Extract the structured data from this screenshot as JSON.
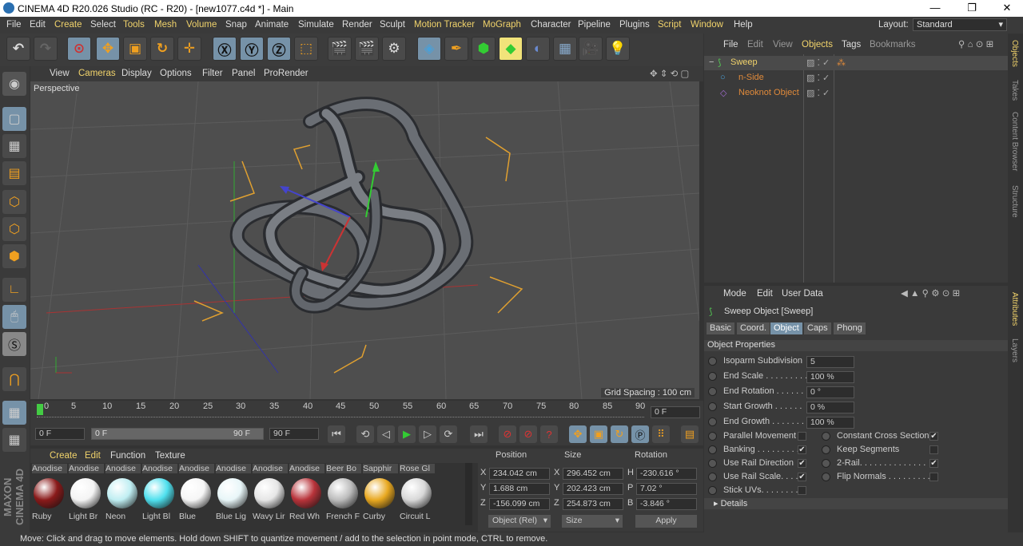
{
  "window": {
    "title": "CINEMA 4D R20.026 Studio (RC - R20) - [new1077.c4d *] - Main",
    "minimize": "—",
    "maximize": "❐",
    "close": "✕"
  },
  "menu": [
    "File",
    "Edit",
    "Create",
    "Select",
    "Tools",
    "Mesh",
    "Volume",
    "Snap",
    "Animate",
    "Simulate",
    "Render",
    "Sculpt",
    "Motion Tracker",
    "MoGraph",
    "Character",
    "Pipeline",
    "Plugins",
    "Script",
    "Window",
    "Help"
  ],
  "layout": {
    "label": "Layout:",
    "value": "Standard"
  },
  "viewport": {
    "menu": [
      "View",
      "Cameras",
      "Display",
      "Options",
      "Filter",
      "Panel",
      "ProRender"
    ],
    "label": "Perspective",
    "grid_spacing": "Grid Spacing : 100 cm"
  },
  "timeline": {
    "ticks": [
      "0",
      "5",
      "10",
      "15",
      "20",
      "25",
      "30",
      "35",
      "40",
      "45",
      "50",
      "55",
      "60",
      "65",
      "70",
      "75",
      "80",
      "85",
      "90"
    ],
    "current_frame": "0 F"
  },
  "controls": {
    "start": "0 F",
    "range_start": "0 F",
    "range_end": "90 F",
    "end": "90 F"
  },
  "materials": {
    "menu": [
      "Create",
      "Edit",
      "Function",
      "Texture"
    ],
    "items": [
      {
        "top": "Anodise",
        "bottom": "Ruby",
        "color": "#8a1a1a"
      },
      {
        "top": "Anodise",
        "bottom": "Light Br",
        "color": "#f4f4f4"
      },
      {
        "top": "Anodise",
        "bottom": "Neon",
        "color": "#bfeef2"
      },
      {
        "top": "Anodise",
        "bottom": "Light Bl",
        "color": "#4fe0ee"
      },
      {
        "top": "Anodise",
        "bottom": "Blue",
        "color": "#f6f6f6"
      },
      {
        "top": "Anodise",
        "bottom": "Blue Lig",
        "color": "#e8f6f8"
      },
      {
        "top": "Anodise",
        "bottom": "Wavy Lir",
        "color": "#e6e6e6"
      },
      {
        "top": "Anodise",
        "bottom": "Red Wh",
        "color": "#b8333a"
      },
      {
        "top": "Beer Bo",
        "bottom": "French F",
        "color": "#bcbcbc"
      },
      {
        "top": "Sapphir",
        "bottom": "Curby",
        "color": "#e8a820"
      },
      {
        "top": "Rose Gl",
        "bottom": "Circuit L",
        "color": "#d8d8d8"
      }
    ]
  },
  "coords": {
    "headers": [
      "Position",
      "Size",
      "Rotation"
    ],
    "rows": [
      {
        "axis": "X",
        "pos": "234.042 cm",
        "saxis": "X",
        "size": "296.452 cm",
        "raxis": "H",
        "rot": "-230.616 °"
      },
      {
        "axis": "Y",
        "pos": "1.688 cm",
        "saxis": "Y",
        "size": "202.423 cm",
        "raxis": "P",
        "rot": "7.02 °"
      },
      {
        "axis": "Z",
        "pos": "-156.099 cm",
        "saxis": "Z",
        "size": "254.873 cm",
        "raxis": "B",
        "rot": "-3.846 °"
      }
    ],
    "mode": "Object (Rel)",
    "size_mode": "Size",
    "apply": "Apply"
  },
  "objects": {
    "menu": [
      "File",
      "Edit",
      "View",
      "Objects",
      "Tags",
      "Bookmarks"
    ],
    "items": [
      {
        "name": "Sweep"
      },
      {
        "name": "n-Side"
      },
      {
        "name": "Neoknot Object"
      }
    ]
  },
  "attributes": {
    "menu": [
      "Mode",
      "Edit",
      "User Data"
    ],
    "title": "Sweep Object [Sweep]",
    "tabs": [
      "Basic",
      "Coord.",
      "Object",
      "Caps",
      "Phong"
    ],
    "section": "Object Properties",
    "props": [
      {
        "label": "Isoparm Subdivision",
        "value": "5"
      },
      {
        "label": "End Scale . . . . . . . . .",
        "value": "100 %"
      },
      {
        "label": "End Rotation . . . . . .",
        "value": "0 °"
      },
      {
        "label": "Start Growth . . . . . .",
        "value": "0 %"
      },
      {
        "label": "End Growth . . . . . . .",
        "value": "100 %"
      }
    ],
    "checks_left": [
      {
        "label": "Parallel Movement",
        "checked": ""
      },
      {
        "label": "Banking . . . . . . . . .",
        "checked": "✔"
      },
      {
        "label": "Use Rail Direction",
        "checked": "✔"
      },
      {
        "label": "Use Rail Scale. . . .",
        "checked": "✔"
      },
      {
        "label": "Stick UVs. . . . . . . .",
        "checked": ""
      }
    ],
    "checks_right": [
      {
        "label": "Constant Cross Section",
        "checked": "✔"
      },
      {
        "label": "Keep Segments",
        "checked": ""
      },
      {
        "label": "2-Rail. . . . . . . . . . . . . .",
        "checked": "✔"
      },
      {
        "label": "Flip Normals . . . . . . . . .",
        "checked": ""
      }
    ],
    "details": "Details"
  },
  "right_tabs": [
    "Objects",
    "Takes",
    "Content Browser",
    "Structure",
    "Attributes",
    "Layers"
  ],
  "brand": "MAXON CINEMA 4D",
  "status": "Move: Click and drag to move elements. Hold down SHIFT to quantize movement / add to the selection in point mode, CTRL to remove."
}
